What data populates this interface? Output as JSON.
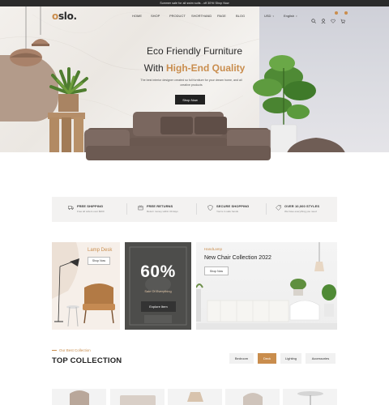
{
  "announcement": "Summer sale for all swim suits - off 30%! Shop Now",
  "header": {
    "logo": "slo.",
    "logo_mark": "o",
    "nav": [
      "HOME",
      "SHOP",
      "PRODUCT",
      "SHORTHAND",
      "PAGE",
      "BLOG"
    ],
    "currency": "USD",
    "language": "English",
    "icons": [
      "search-icon",
      "user-icon",
      "heart-icon",
      "cart-icon"
    ]
  },
  "hero": {
    "title_line1": "Eco Friendly Furniture",
    "title_line2_prefix": "With",
    "title_line2_highlight": "High-End Quality",
    "description": "The best interior designer created so full furniture for your dream home, and all creative products",
    "button": "Shop Now"
  },
  "features": [
    {
      "title": "FREE SHIPPING",
      "subtitle": "Free all orders over $200",
      "icon": "truck-icon"
    },
    {
      "title": "FREE RETURNS",
      "subtitle": "Return money within 30 days",
      "icon": "return-icon"
    },
    {
      "title": "SECURE SHOPPING",
      "subtitle": "You're in safe hands",
      "icon": "shield-icon"
    },
    {
      "title": "OVER 10,000 STYLES",
      "subtitle": "We have everything you need",
      "icon": "tag-icon"
    }
  ],
  "banners": {
    "lamp": {
      "title": "Lamp Desk",
      "button": "Shop Now"
    },
    "sale": {
      "big": "60%",
      "small": "Sale Of Everything",
      "button": "Explore Item"
    },
    "chair": {
      "tag": "HandLamp",
      "title": "New Chair Collection 2022",
      "button": "Shop Now"
    }
  },
  "collection": {
    "subtitle": "Our Best Collection",
    "title": "TOP COLLECTION",
    "tabs": [
      "Bedroom",
      "Deck",
      "Lighting",
      "Accessories"
    ],
    "active_tab": "Deck"
  },
  "colors": {
    "accent": "#c98d4d",
    "dark": "#222222",
    "strip": "#f3f2f1"
  }
}
